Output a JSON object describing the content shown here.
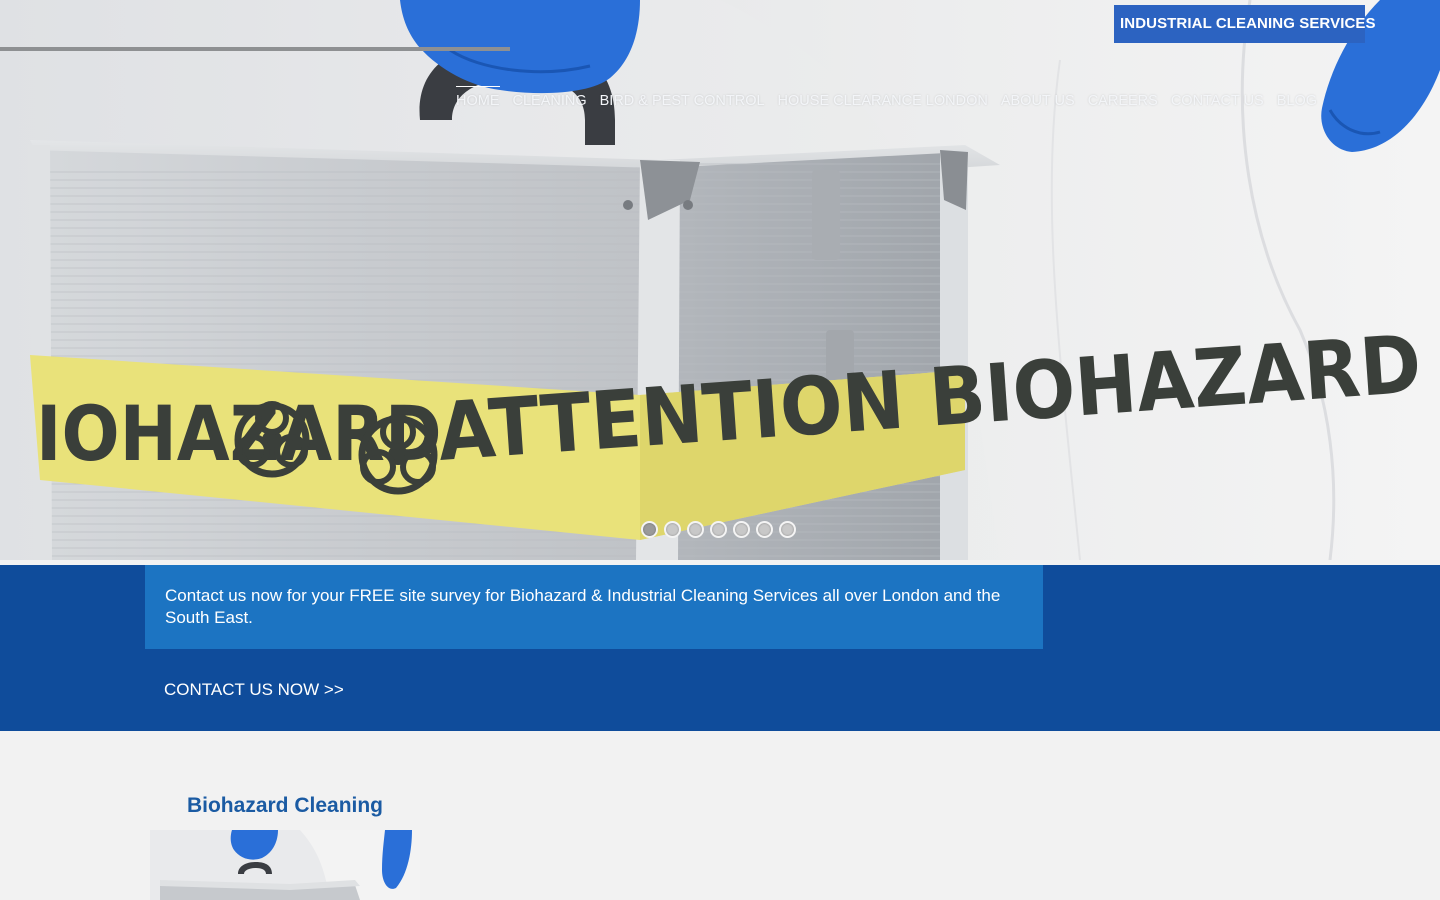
{
  "header": {
    "brand_badge": "INDUSTRIAL CLEANING SERVICES",
    "nav": [
      {
        "label": "HOME",
        "active": true
      },
      {
        "label": "CLEANING"
      },
      {
        "label": "BIRD & PEST CONTROL"
      },
      {
        "label": "HOUSE CLEARANCE LONDON"
      },
      {
        "label": "ABOUT US"
      },
      {
        "label": "CAREERS"
      },
      {
        "label": "CONTACT US"
      },
      {
        "label": "BLOG"
      }
    ]
  },
  "hero": {
    "tape_text_left": "IOHAZARD",
    "tape_text_main": "ATTENTION BIOHAZARD",
    "slider": {
      "count": 7,
      "active": 1
    }
  },
  "band": {
    "message": "Contact us now for your FREE site survey for Biohazard & Industrial Cleaning Services all over London and the South East.",
    "cta": "CONTACT US NOW >>"
  },
  "services": [
    {
      "title": "Biohazard Cleaning"
    }
  ],
  "colors": {
    "band": "#0f4c9b",
    "message_box": "#1c74c2",
    "badge": "#2c63c1",
    "title": "#1b5ba3",
    "page_bg": "#f2f2f2",
    "glove": "#2a6fd8",
    "tape": "#e9e27a"
  },
  "icons": [
    "biohazard-icon"
  ]
}
